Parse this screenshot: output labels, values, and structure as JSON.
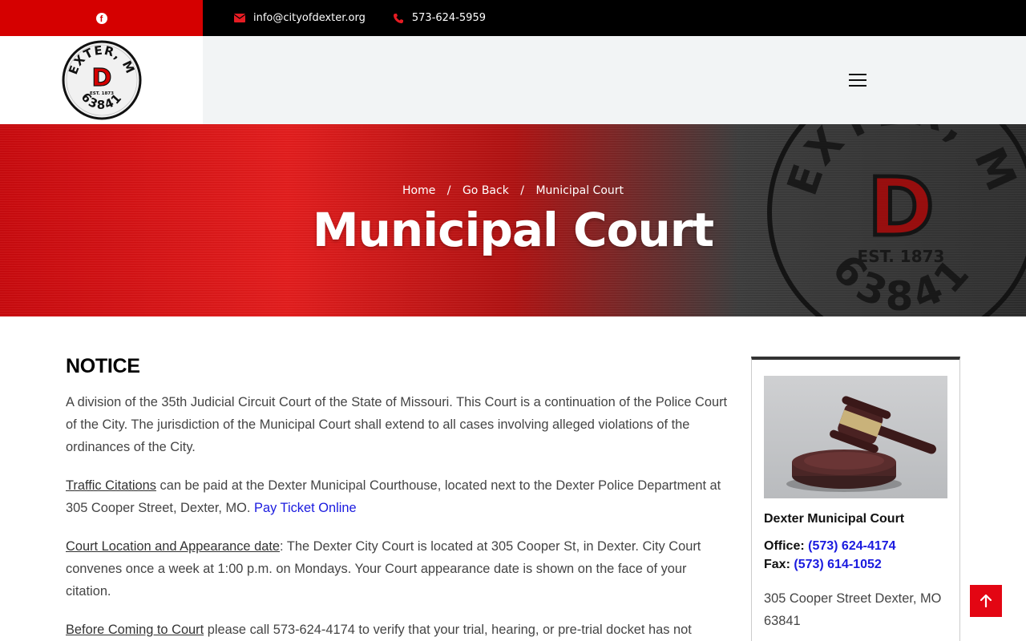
{
  "topbar": {
    "social_icon": "facebook-icon",
    "email": "info@cityofdexter.org",
    "phone": "573-624-5959",
    "colors": {
      "accent": "#d50000",
      "bar": "#000000"
    }
  },
  "header": {
    "logo": {
      "top_text": "DEXTER, MO",
      "letter": "D",
      "est": "EST. 1873",
      "bottom_text": "63841"
    },
    "menu_icon": "hamburger-icon"
  },
  "banner": {
    "breadcrumb": {
      "home": "Home",
      "back": "Go Back",
      "current": "Municipal Court",
      "separator": "/"
    },
    "title": "Municipal Court"
  },
  "main": {
    "heading": "NOTICE",
    "p1": "A division of the 35th Judicial Circuit Court of the State of Missouri. This Court is a continuation of the Police Court of the City. The jurisdiction of the Municipal Court shall extend to all cases involving alleged violations of the ordinances of the City.",
    "p2": {
      "lead": "Traffic Citations",
      "text": " can be paid at the Dexter Municipal Courthouse, located next to the Dexter Police Department at 305 Cooper Street, Dexter, MO. ",
      "link": "Pay Ticket Online"
    },
    "p3": {
      "lead": "Court Location and Appearance date",
      "text": ": The Dexter City Court is located at 305 Cooper St, in Dexter. City Court convenes once a week at 1:00 p.m. on Mondays. Your Court appearance date is shown on the face of your citation."
    },
    "p4": {
      "lead": "Before Coming to Court",
      "text": " please call 573-624-4174 to verify that your trial, hearing, or pre-trial docket has not"
    }
  },
  "sidebar": {
    "image_icon": "gavel-image",
    "title": "Dexter Municipal Court",
    "office_label": "Office:",
    "office_phone": "(573) 624-4174",
    "fax_label": "Fax:",
    "fax_phone": "(573) 614-1052",
    "address": "305 Cooper Street Dexter, MO 63841"
  },
  "back_to_top": {
    "icon": "arrow-up-icon"
  }
}
